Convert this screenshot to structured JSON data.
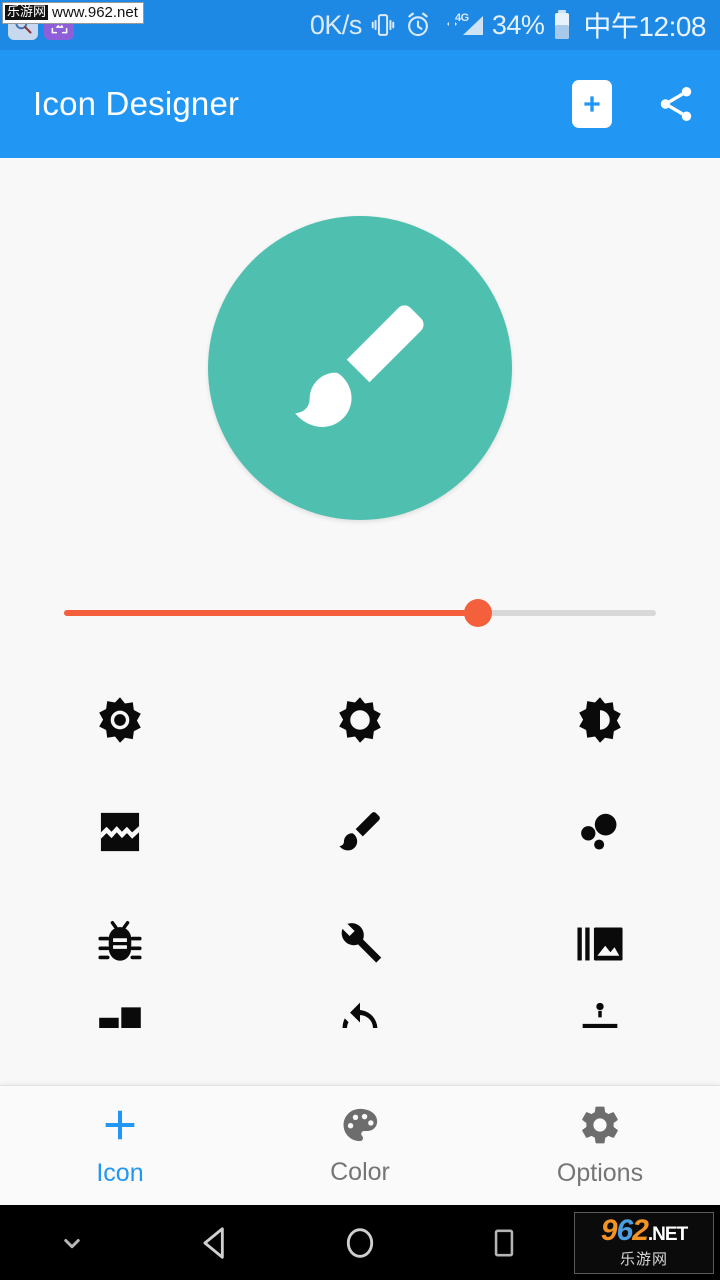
{
  "statusbar": {
    "network_speed": "0K/s",
    "battery_percent": "34%",
    "clock": "中午12:08",
    "signal_label": "4G",
    "icons": [
      "vibrate-icon",
      "alarm-icon",
      "signal-icon",
      "battery-icon"
    ],
    "watermark": {
      "cn": "乐游网",
      "url": "www.962.net"
    },
    "app_icons": [
      "magnifier-app-icon",
      "image-app-icon"
    ],
    "background_color": "#1e88e5"
  },
  "appbar": {
    "title": "Icon Designer",
    "background_color": "#2196f3",
    "add_icon": "add-icon",
    "share_icon": "share-icon"
  },
  "preview": {
    "shape": "circle",
    "background_color": "#4fc0b0",
    "glyph": "brush-icon",
    "glyph_color": "#ffffff"
  },
  "slider": {
    "name": "size-slider",
    "value_percent": 70,
    "active_color": "#f4603c",
    "track_color": "#d8d8d8"
  },
  "icon_grid": {
    "columns": 3,
    "items": [
      {
        "name": "brightness-high-icon",
        "row": 1,
        "col": 1
      },
      {
        "name": "brightness-low-icon",
        "row": 1,
        "col": 2
      },
      {
        "name": "brightness-medium-icon",
        "row": 1,
        "col": 3
      },
      {
        "name": "broken-image-icon",
        "row": 2,
        "col": 1
      },
      {
        "name": "brush-icon",
        "row": 2,
        "col": 2
      },
      {
        "name": "bubble-chart-icon",
        "row": 3,
        "col": 3
      },
      {
        "name": "bug-report-icon",
        "row": 3,
        "col": 1
      },
      {
        "name": "build-wrench-icon",
        "row": 3,
        "col": 2
      },
      {
        "name": "burst-mode-icon",
        "row": 3,
        "col": 3
      },
      {
        "name": "business-icon",
        "row": 4,
        "col": 1
      },
      {
        "name": "cached-icon",
        "row": 4,
        "col": 2
      },
      {
        "name": "cake-icon",
        "row": 4,
        "col": 3
      }
    ],
    "icon_color": "#000000"
  },
  "bottomnav": {
    "active_color": "#2196f3",
    "inactive_color": "#757575",
    "items": [
      {
        "label": "Icon",
        "icon": "plus-icon",
        "active": true
      },
      {
        "label": "Color",
        "icon": "palette-icon",
        "active": false
      },
      {
        "label": "Options",
        "icon": "gear-icon",
        "active": false
      }
    ]
  },
  "sysnav": {
    "buttons": [
      "chevron-down-icon",
      "back-icon",
      "home-icon",
      "recents-icon"
    ],
    "watermark": {
      "num_9": "9",
      "num_6": "6",
      "num_2": "2",
      "net": ".NET",
      "cn": "乐游网"
    }
  }
}
